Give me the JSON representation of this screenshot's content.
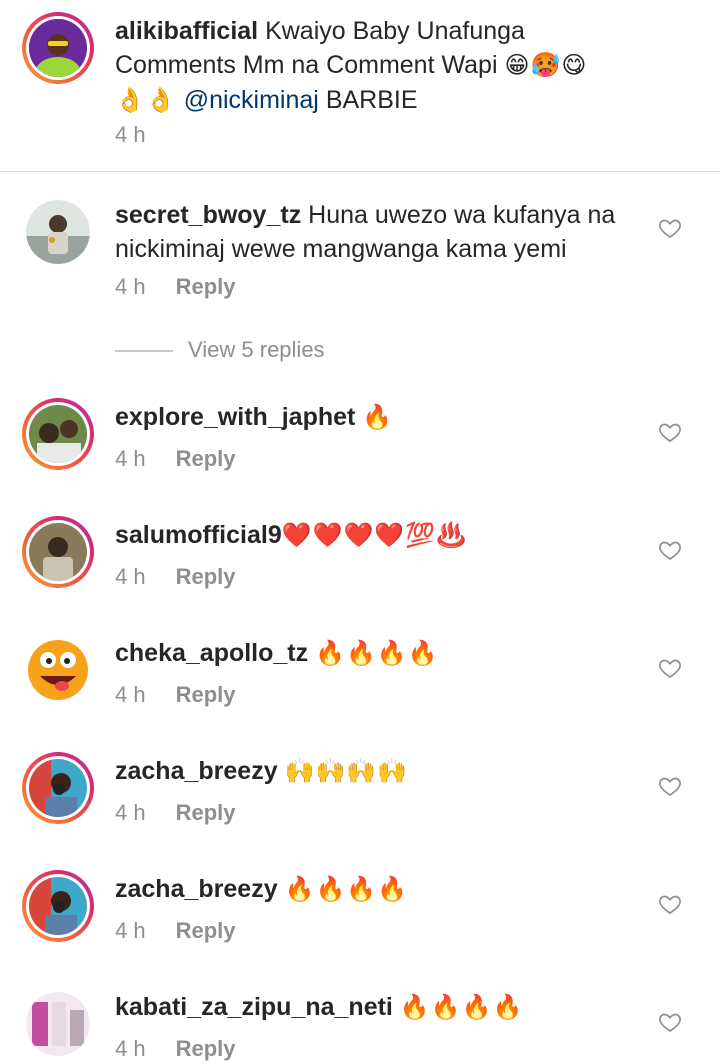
{
  "caption": {
    "username": "alikibafficial",
    "text_line1": "Kwaiyo Baby Unafunga",
    "text_line2": "Comments Mm na Comment Wapi",
    "line2_emojis": "😁🥵😋",
    "line3_emojis": "👌👌",
    "mention": "@nickiminaj",
    "text_end": "BARBIE",
    "time": "4 h"
  },
  "reply_label": "Reply",
  "view_replies": "View 5 replies",
  "comments": [
    {
      "username": "secret_bwoy_tz",
      "text_line1": "Huna uwezo wa kufanya na",
      "text_line2": "nickiminaj wewe mangwanga kama yemi",
      "emojis": "",
      "time": "4 h"
    },
    {
      "username": "explore_with_japhet",
      "text_line1": "",
      "emojis": "🔥",
      "time": "4 h"
    },
    {
      "username": "salumofficial9",
      "text_line1": "",
      "emojis": "❤️❤️❤️❤️💯♨️",
      "time": "4 h"
    },
    {
      "username": "cheka_apollo_tz",
      "text_line1": "",
      "emojis": "🔥🔥🔥🔥",
      "time": "4 h"
    },
    {
      "username": "zacha_breezy",
      "text_line1": "",
      "emojis": "🙌🙌🙌🙌",
      "time": "4 h"
    },
    {
      "username": "zacha_breezy",
      "text_line1": "",
      "emojis": "🔥🔥🔥🔥",
      "time": "4 h"
    },
    {
      "username": "kabati_za_zipu_na_neti",
      "text_line1": "",
      "emojis": "🔥🔥🔥🔥",
      "time": "4 h"
    }
  ],
  "icons": {
    "like": "heart-outline-icon"
  },
  "colors": {
    "text": "#262626",
    "secondary": "#8e8e8e",
    "mention": "#00376b",
    "divider": "#dbdbdb"
  }
}
